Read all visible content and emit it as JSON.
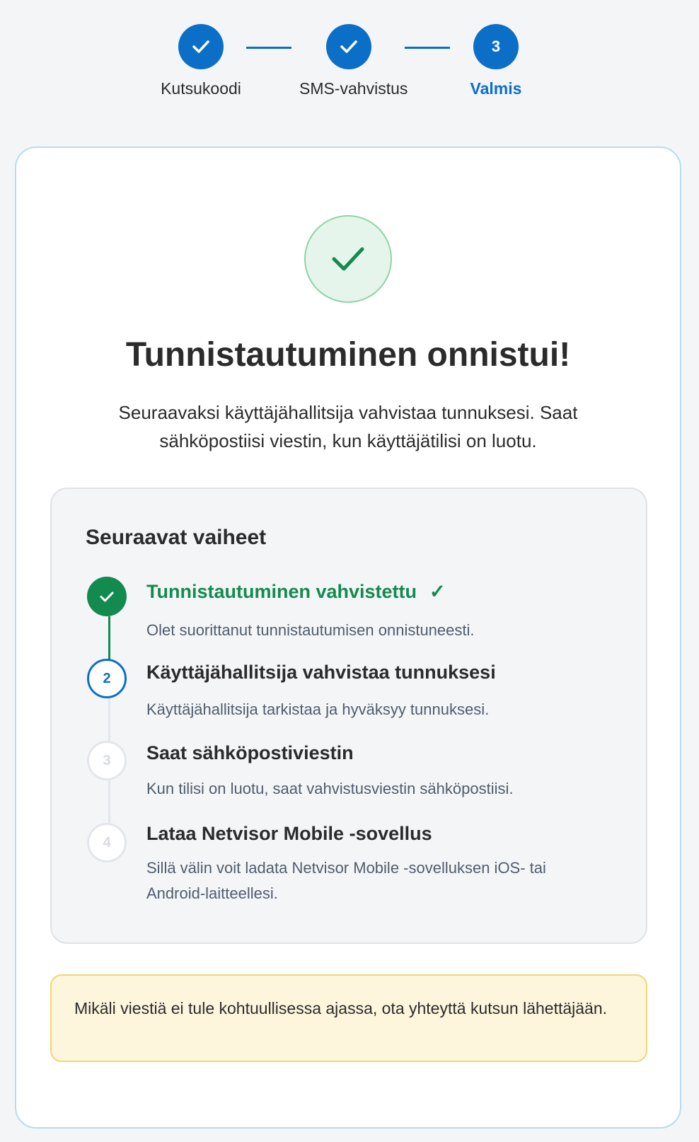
{
  "stepper": {
    "steps": [
      {
        "label": "Kutsukoodi",
        "state": "done"
      },
      {
        "label": "SMS-vahvistus",
        "state": "done"
      },
      {
        "label": "Valmis",
        "state": "active",
        "number": "3"
      }
    ]
  },
  "card": {
    "title": "Tunnistautuminen onnistui!",
    "subtitle": "Seuraavaksi käyttäjähallitsija vahvistaa tunnuksesi. Saat sähköpostiisi viestin, kun käyttäjätilisi on luotu."
  },
  "next_steps": {
    "heading": "Seuraavat vaiheet",
    "items": [
      {
        "number": "1",
        "title": "Tunnistautuminen vahvistettu",
        "title_mark": "✓",
        "description": "Olet suorittanut tunnistautumisen onnistuneesti.",
        "state": "done"
      },
      {
        "number": "2",
        "title": "Käyttäjähallitsija vahvistaa tunnuksesi",
        "description": "Käyttäjähallitsija tarkistaa ja hyväksyy tunnuksesi.",
        "state": "current"
      },
      {
        "number": "3",
        "title": "Saat sähköpostiviestin",
        "description": "Kun tilisi on luotu, saat vahvistusviestin sähköpostiisi.",
        "state": "pending"
      },
      {
        "number": "4",
        "title": "Lataa Netvisor Mobile -sovellus",
        "description": "Sillä välin voit ladata Netvisor Mobile -sovelluksen iOS- tai Android-laitteellesi.",
        "state": "pending"
      }
    ]
  },
  "notice": {
    "text": "Mikäli viestiä ei tule kohtuullisessa ajassa, ota yhteyttä kutsun lähettäjään."
  },
  "colors": {
    "primary": "#0b6fc7",
    "success": "#138a4e",
    "success_bg": "#e6f5ec",
    "notice_bg": "#fdf6dc",
    "notice_border": "#f1d675",
    "card_border": "#b8dcf0"
  },
  "icons": {
    "done_step": "check-icon",
    "success": "check-icon"
  }
}
